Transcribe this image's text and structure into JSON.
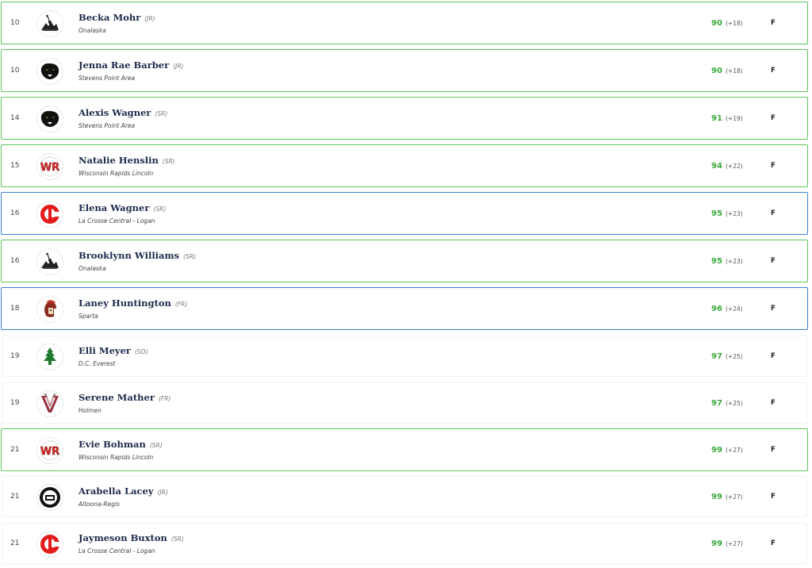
{
  "rows": [
    {
      "rank": "10",
      "name": "Becka Mohr",
      "grade": "(JR)",
      "school": "Onalaska",
      "score": "90",
      "diff": "(+18)",
      "status": "F",
      "logo": "onalaska-logo-icon",
      "border": "green"
    },
    {
      "rank": "10",
      "name": "Jenna Rae Barber",
      "grade": "(JR)",
      "school": "Stevens Point Area",
      "score": "90",
      "diff": "(+18)",
      "status": "F",
      "logo": "panther-logo-icon",
      "border": "green"
    },
    {
      "rank": "14",
      "name": "Alexis Wagner",
      "grade": "(SR)",
      "school": "Stevens Point Area",
      "score": "91",
      "diff": "(+19)",
      "status": "F",
      "logo": "panther-logo-icon",
      "border": "green"
    },
    {
      "rank": "15",
      "name": "Natalie Henslin",
      "grade": "(SR)",
      "school": "Wisconsin Rapids Lincoln",
      "score": "94",
      "diff": "(+22)",
      "status": "F",
      "logo": "wr-logo-icon",
      "border": "green"
    },
    {
      "rank": "16",
      "name": "Elena Wagner",
      "grade": "(SR)",
      "school": "La Crosse Central - Logan",
      "score": "95",
      "diff": "(+23)",
      "status": "F",
      "logo": "lc-logo-icon",
      "border": "blue"
    },
    {
      "rank": "16",
      "name": "Brooklynn Williams",
      "grade": "(SR)",
      "school": "Onalaska",
      "score": "95",
      "diff": "(+23)",
      "status": "F",
      "logo": "onalaska-logo-icon",
      "border": "green"
    },
    {
      "rank": "18",
      "name": "Laney Huntington",
      "grade": "(FR)",
      "school": "Sparta",
      "score": "96",
      "diff": "(+24)",
      "status": "F",
      "logo": "spartan-logo-icon",
      "border": "blue"
    },
    {
      "rank": "19",
      "name": "Elli Meyer",
      "grade": "(SO)",
      "school": "D.C. Everest",
      "score": "97",
      "diff": "(+25)",
      "status": "F",
      "logo": "evergreen-tree-logo-icon",
      "border": "none"
    },
    {
      "rank": "19",
      "name": "Serene Mather",
      "grade": "(FR)",
      "school": "Holmen",
      "score": "97",
      "diff": "(+25)",
      "status": "F",
      "logo": "viking-v-logo-icon",
      "border": "none"
    },
    {
      "rank": "21",
      "name": "Evie Bohman",
      "grade": "(SR)",
      "school": "Wisconsin Rapids Lincoln",
      "score": "99",
      "diff": "(+27)",
      "status": "F",
      "logo": "wr-logo-icon",
      "border": "green"
    },
    {
      "rank": "21",
      "name": "Arabella Lacey",
      "grade": "(JR)",
      "school": "Altoona-Regis",
      "score": "99",
      "diff": "(+27)",
      "status": "F",
      "logo": "altoona-regis-logo-icon",
      "border": "none"
    },
    {
      "rank": "21",
      "name": "Jaymeson Buxton",
      "grade": "(SR)",
      "school": "La Crosse Central - Logan",
      "score": "99",
      "diff": "(+27)",
      "status": "F",
      "logo": "lc-logo-icon",
      "border": "none"
    }
  ],
  "colors": {
    "score": "#3aa93a",
    "name": "#1d2a4a",
    "border_green": "#5cc45c",
    "border_blue": "#3d7fd6"
  }
}
